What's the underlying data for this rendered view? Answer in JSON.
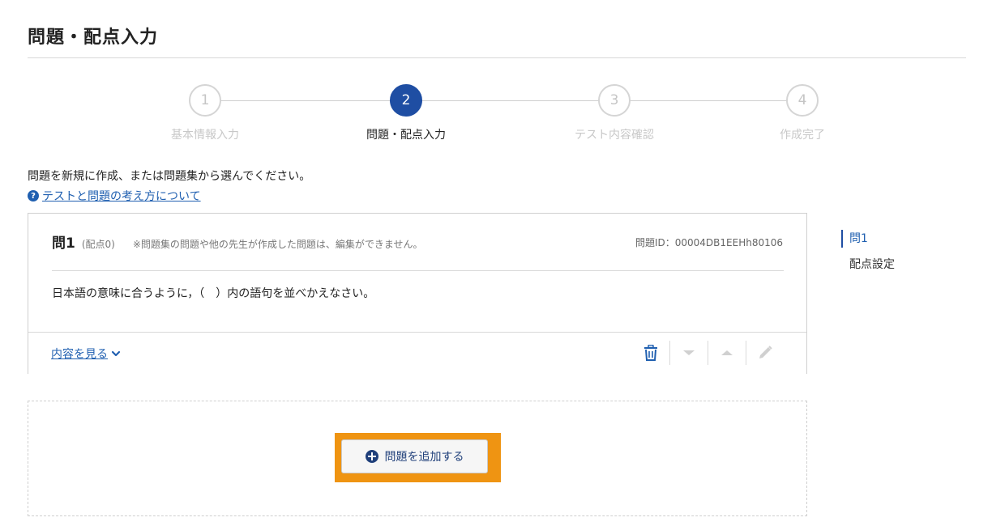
{
  "page": {
    "title": "問題・配点入力"
  },
  "stepper": {
    "steps": [
      {
        "number": "1",
        "label": "基本情報入力",
        "state": "done"
      },
      {
        "number": "2",
        "label": "問題・配点入力",
        "state": "active"
      },
      {
        "number": "3",
        "label": "テスト内容確認",
        "state": "pending"
      },
      {
        "number": "4",
        "label": "作成完了",
        "state": "pending"
      }
    ]
  },
  "intro": {
    "text": "問題を新規に作成、または問題集から選んでください。",
    "help_link": "テストと問題の考え方について"
  },
  "question": {
    "number": "問1",
    "score": "(配点0)",
    "note": "※問題集の問題や他の先生が作成した問題は、編集ができません。",
    "id_label": "問題ID：00004DB1EEHh80106",
    "body": "日本語の意味に合うように，（　）内の語句を並べかえなさい。",
    "view_link": "内容を見る"
  },
  "side_nav": {
    "items": [
      {
        "label": "問1",
        "active": true
      },
      {
        "label": "配点設定",
        "active": false
      }
    ]
  },
  "add": {
    "button_label": "問題を追加する"
  },
  "colors": {
    "accent": "#1f4ea3",
    "link": "#1f5fb0",
    "highlight": "#ef9412"
  }
}
